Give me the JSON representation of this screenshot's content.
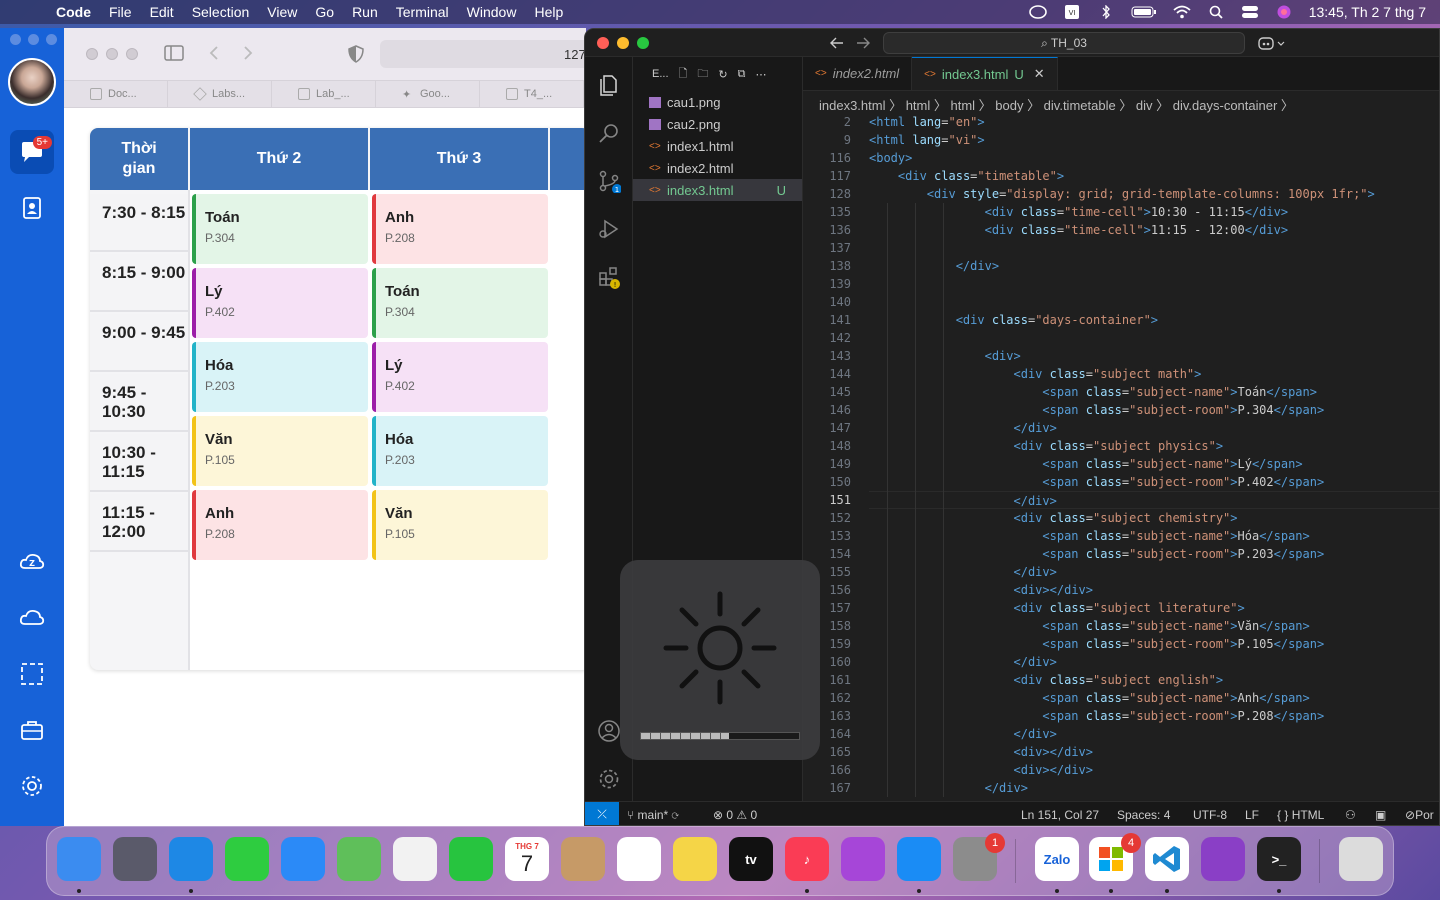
{
  "menubar": {
    "app": "Code",
    "items": [
      "File",
      "Edit",
      "Selection",
      "View",
      "Go",
      "Run",
      "Terminal",
      "Window",
      "Help"
    ],
    "clock": "13:45, Th 2 7 thg 7"
  },
  "zalo": {
    "badge": "5+"
  },
  "browser": {
    "url": "127",
    "tabs": [
      "Doc...",
      "Labs...",
      "Lab_...",
      "Goo...",
      "T4_..."
    ]
  },
  "timetable": {
    "headers": [
      "Thời gian",
      "Thứ 2",
      "Thứ 3"
    ],
    "times": [
      "7:30 - 8:15",
      "8:15 - 9:00",
      "9:00 - 9:45",
      "9:45 - 10:30",
      "10:30 - 11:15",
      "11:15 - 12:00"
    ],
    "day1": [
      {
        "name": "Toán",
        "room": "P.304",
        "type": "math"
      },
      {
        "name": "Lý",
        "room": "P.402",
        "type": "physics"
      },
      {
        "name": "Hóa",
        "room": "P.203",
        "type": "chemistry"
      },
      {
        "name": "Văn",
        "room": "P.105",
        "type": "literature"
      },
      {
        "name": "Anh",
        "room": "P.208",
        "type": "english"
      }
    ],
    "day2": [
      {
        "name": "Anh",
        "room": "P.208",
        "type": "english"
      },
      {
        "name": "Toán",
        "room": "P.304",
        "type": "math"
      },
      {
        "name": "Lý",
        "room": "P.402",
        "type": "physics"
      },
      {
        "name": "Hóa",
        "room": "P.203",
        "type": "chemistry"
      },
      {
        "name": "Văn",
        "room": "P.105",
        "type": "literature"
      }
    ]
  },
  "vscode": {
    "search": "TH_03",
    "explorer_title": "E...",
    "files": [
      {
        "name": "cau1.png",
        "kind": "png"
      },
      {
        "name": "cau2.png",
        "kind": "png"
      },
      {
        "name": "index1.html",
        "kind": "html"
      },
      {
        "name": "index2.html",
        "kind": "html"
      },
      {
        "name": "index3.html",
        "kind": "html",
        "status": "U"
      }
    ],
    "tabs": [
      {
        "label": "index2.html"
      },
      {
        "label": "index3.html",
        "status": "U"
      }
    ],
    "breadcrumb": "index3.html 〉 html 〉 html 〉 body 〉 div.timetable 〉 div 〉 div.days-container 〉",
    "current_line": "151",
    "lines": [
      {
        "n": "2",
        "c": "<html lang=\"en\">"
      },
      {
        "n": "9",
        "c": "<html lang=\"vi\">"
      },
      {
        "n": "116",
        "c": "<body>"
      },
      {
        "n": "117",
        "c": "    <div class=\"timetable\">"
      },
      {
        "n": "128",
        "c": "        <div style=\"display: grid; grid-template-columns: 100px 1fr;\">"
      },
      {
        "n": "135",
        "c": "                <div class=\"time-cell\">10:30 - 11:15</div>"
      },
      {
        "n": "136",
        "c": "                <div class=\"time-cell\">11:15 - 12:00</div>"
      },
      {
        "n": "137",
        "c": ""
      },
      {
        "n": "138",
        "c": "            </div>"
      },
      {
        "n": "139",
        "c": ""
      },
      {
        "n": "140",
        "c": ""
      },
      {
        "n": "141",
        "c": "            <div class=\"days-container\">"
      },
      {
        "n": "142",
        "c": ""
      },
      {
        "n": "143",
        "c": "                <div>"
      },
      {
        "n": "144",
        "c": "                    <div class=\"subject math\">"
      },
      {
        "n": "145",
        "c": "                        <span class=\"subject-name\">Toán</span>"
      },
      {
        "n": "146",
        "c": "                        <span class=\"subject-room\">P.304</span>"
      },
      {
        "n": "147",
        "c": "                    </div>"
      },
      {
        "n": "148",
        "c": "                    <div class=\"subject physics\">"
      },
      {
        "n": "149",
        "c": "                        <span class=\"subject-name\">Lý</span>"
      },
      {
        "n": "150",
        "c": "                        <span class=\"subject-room\">P.402</span>"
      },
      {
        "n": "151",
        "c": "                    </div>"
      },
      {
        "n": "152",
        "c": "                    <div class=\"subject chemistry\">"
      },
      {
        "n": "153",
        "c": "                        <span class=\"subject-name\">Hóa</span>"
      },
      {
        "n": "154",
        "c": "                        <span class=\"subject-room\">P.203</span>"
      },
      {
        "n": "155",
        "c": "                    </div>"
      },
      {
        "n": "156",
        "c": "                    <div></div>"
      },
      {
        "n": "157",
        "c": "                    <div class=\"subject literature\">"
      },
      {
        "n": "158",
        "c": "                        <span class=\"subject-name\">Văn</span>"
      },
      {
        "n": "159",
        "c": "                        <span class=\"subject-room\">P.105</span>"
      },
      {
        "n": "160",
        "c": "                    </div>"
      },
      {
        "n": "161",
        "c": "                    <div class=\"subject english\">"
      },
      {
        "n": "162",
        "c": "                        <span class=\"subject-name\">Anh</span>"
      },
      {
        "n": "163",
        "c": "                        <span class=\"subject-room\">P.208</span>"
      },
      {
        "n": "164",
        "c": "                    </div>"
      },
      {
        "n": "165",
        "c": "                    <div></div>"
      },
      {
        "n": "166",
        "c": "                    <div></div>"
      },
      {
        "n": "167",
        "c": "                </div>"
      }
    ],
    "status": {
      "branch": "main*",
      "problems": "⊗ 0 ⚠ 0",
      "position": "Ln 151, Col 27",
      "spaces": "Spaces: 4",
      "encoding": "UTF-8",
      "eol": "LF",
      "language": "HTML",
      "extra": "Por"
    }
  },
  "brightness": {
    "level": 0.56
  },
  "dock": {
    "calendar_month": "THG 7",
    "calendar_day": "7",
    "badges": {
      "settings": "1",
      "microsoft": "4"
    },
    "apps": [
      {
        "name": "finder",
        "label": "",
        "color": "#3b8cf0"
      },
      {
        "name": "launchpad",
        "label": "",
        "color": "#5a5a6a"
      },
      {
        "name": "safari",
        "label": "",
        "color": "#1e88e5"
      },
      {
        "name": "messages",
        "label": "",
        "color": "#2ecc40"
      },
      {
        "name": "mail",
        "label": "",
        "color": "#2b8af7"
      },
      {
        "name": "maps",
        "label": "",
        "color": "#5fbf5a"
      },
      {
        "name": "photos",
        "label": "",
        "color": "#f2f2f2"
      },
      {
        "name": "facetime",
        "label": "",
        "color": "#27c43f"
      },
      {
        "name": "calendar",
        "label": "",
        "color": "#ffffff"
      },
      {
        "name": "contacts",
        "label": "",
        "color": "#c69a67"
      },
      {
        "name": "reminders",
        "label": "",
        "color": "#ffffff"
      },
      {
        "name": "notes",
        "label": "",
        "color": "#f5d547"
      },
      {
        "name": "tv",
        "label": "tv",
        "color": "#111111"
      },
      {
        "name": "music",
        "label": "♪",
        "color": "#fa3c55"
      },
      {
        "name": "podcasts",
        "label": "",
        "color": "#a646d8"
      },
      {
        "name": "appstore",
        "label": "",
        "color": "#1a8cf5"
      },
      {
        "name": "settings",
        "label": "",
        "color": "#8c8c8c"
      },
      {
        "name": "zalo",
        "label": "Zalo",
        "color": "#ffffff"
      },
      {
        "name": "microsoft",
        "label": "",
        "color": "#ffffff"
      },
      {
        "name": "vscode",
        "label": "",
        "color": "#ffffff"
      },
      {
        "name": "github",
        "label": "",
        "color": "#8a3fc6"
      },
      {
        "name": "terminal",
        "label": ">_",
        "color": "#222222"
      },
      {
        "name": "trash",
        "label": "",
        "color": "#dcdcdc"
      }
    ]
  }
}
